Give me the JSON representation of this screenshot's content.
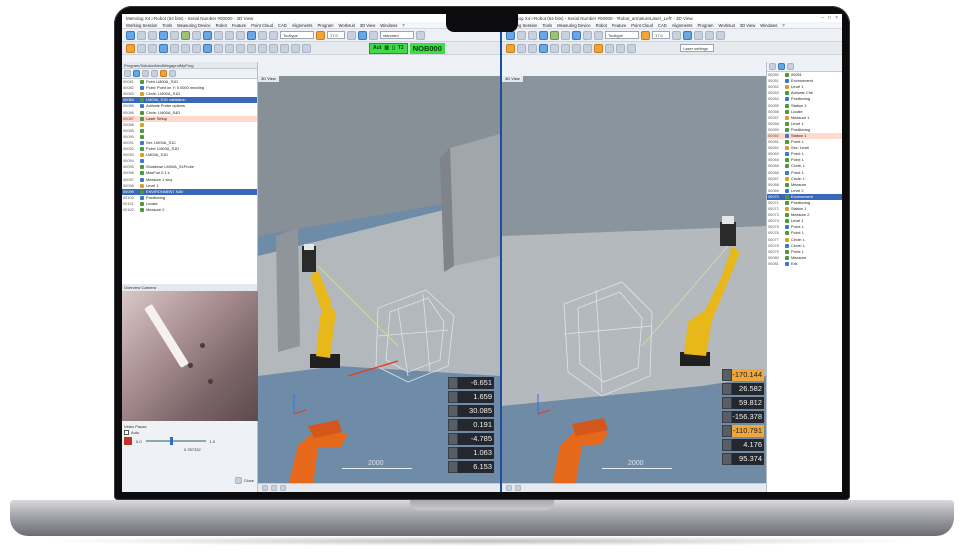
{
  "left_window": {
    "title": "Metrolog X4 i-Robot (64 bits) - Serial Number #00000 - 3D View",
    "menu": [
      "Working Session",
      "Tools",
      "Measuring Device",
      "Robot",
      "Feature",
      "Point Cloud",
      "CAD",
      "Alignments",
      "Program",
      "Worksuit",
      "3D View",
      "Windows",
      "?"
    ],
    "combo1": "Tooltype",
    "combo2": "17.0",
    "combo3": "standard",
    "status_label": "Aut",
    "status_code": "T2",
    "status_name": "NOB000",
    "tree_header": "Program/SolutionNextMegaprolMyProg",
    "tree_rows": [
      {
        "n": "00081",
        "t": "Point LM00A_S1D"
      },
      {
        "n": "00082",
        "t": "Point: Point on Y: 0.0000 mm/deg"
      },
      {
        "n": "00083",
        "t": "Circle: LM00A_S1D"
      },
      {
        "n": "00084",
        "t": "LM00A_S1D validation"
      },
      {
        "n": "00085",
        "t": "Activate Probe options"
      },
      {
        "n": "00086",
        "t": "Circle: LM00A_S4D"
      },
      {
        "n": "00087",
        "t": "Laser Setup"
      },
      {
        "n": "00088",
        "t": ""
      },
      {
        "n": "00089",
        "t": ""
      },
      {
        "n": "00090",
        "t": ""
      },
      {
        "n": "00091",
        "t": "Set: LM00A_S1C"
      },
      {
        "n": "00092",
        "t": "Point: LM00A_S1D"
      },
      {
        "n": "00093",
        "t": "LM00A_S1D"
      },
      {
        "n": "00094",
        "t": ""
      },
      {
        "n": "00095",
        "t": "Shutdown LM00A_S1Probe"
      },
      {
        "n": "00096",
        "t": "MaxFun 0.1 s"
      },
      {
        "n": "00097",
        "t": "Measure 1 seq"
      },
      {
        "n": "00098",
        "t": "Level 1"
      },
      {
        "n": "00099",
        "t": "ENVIRONMENT NAV"
      },
      {
        "n": "00100",
        "t": "Positioning"
      },
      {
        "n": "00101",
        "t": "Locate"
      },
      {
        "n": "00102",
        "t": "Measure 2"
      }
    ],
    "camera_title": "Overview Camera",
    "camera_ctl_label": "Video Pause",
    "camera_check": "Auto",
    "camera_val1": "0.0",
    "camera_val2": "1.0",
    "camera_val3": "0.787332",
    "camera_btn": "Close",
    "view_tab": "3D View",
    "scale": "2000",
    "readouts": [
      "-6.651",
      "1.659",
      "30.085",
      "0.191",
      "-4.785",
      "1.063",
      "6.153"
    ]
  },
  "right_window": {
    "title": "Metrolog X4 i-Robot (64 bits) - Serial Number #00000 - 'Robot_armatureLaser_Left' - 3D View",
    "menu": [
      "Working Session",
      "Tools",
      "Measuring Device",
      "Robot",
      "Feature",
      "Point Cloud",
      "CAD",
      "Alignments",
      "Program",
      "Worksuit",
      "3D View",
      "Windows",
      "?"
    ],
    "combo1": "Tooltype",
    "combo2": "17.0",
    "combo3": "Laser settings",
    "view_tab": "3D View",
    "scale": "2000",
    "readouts": [
      {
        "v": "-170.144",
        "hl": true
      },
      {
        "v": "26.582",
        "hl": false
      },
      {
        "v": "59.812",
        "hl": false
      },
      {
        "v": "-156.378",
        "hl": false
      },
      {
        "v": "-110.791",
        "hl": true
      },
      {
        "v": "4.176",
        "hl": false
      },
      {
        "v": "95.374",
        "hl": false
      }
    ],
    "tree_rows": [
      {
        "n": "00050",
        "t": "00051"
      },
      {
        "n": "00051",
        "t": "Environment"
      },
      {
        "n": "00052",
        "t": "Level 1"
      },
      {
        "n": "00053",
        "t": "Activate Chk"
      },
      {
        "n": "00054",
        "t": "Positioning"
      },
      {
        "n": "00055",
        "t": "Station 1"
      },
      {
        "n": "00056",
        "t": "Locate"
      },
      {
        "n": "00057",
        "t": "Measure 1"
      },
      {
        "n": "00058",
        "t": "Level 1"
      },
      {
        "n": "00059",
        "t": "Positioning"
      },
      {
        "n": "00060",
        "t": "Station 1"
      },
      {
        "n": "00061",
        "t": "Point: L"
      },
      {
        "n": "00062",
        "t": "Sec: Level"
      },
      {
        "n": "00063",
        "t": "Point: L"
      },
      {
        "n": "00064",
        "t": "Point: L"
      },
      {
        "n": "00065",
        "t": "Circle: L"
      },
      {
        "n": "00066",
        "t": "Point: L"
      },
      {
        "n": "00067",
        "t": "Circle: L"
      },
      {
        "n": "00068",
        "t": "Measure"
      },
      {
        "n": "00069",
        "t": "Level 2"
      },
      {
        "n": "00070",
        "t": "Environment"
      },
      {
        "n": "00071",
        "t": "Positioning"
      },
      {
        "n": "00072",
        "t": "Station 1"
      },
      {
        "n": "00073",
        "t": "Measure 2"
      },
      {
        "n": "00074",
        "t": "Level 1"
      },
      {
        "n": "00075",
        "t": "Point: L"
      },
      {
        "n": "00076",
        "t": "Point: L"
      },
      {
        "n": "00077",
        "t": "Circle: L"
      },
      {
        "n": "00078",
        "t": "Circle: L"
      },
      {
        "n": "00079",
        "t": "Point: L"
      },
      {
        "n": "00080",
        "t": "Measure"
      },
      {
        "n": "00081",
        "t": "Exit"
      }
    ]
  }
}
